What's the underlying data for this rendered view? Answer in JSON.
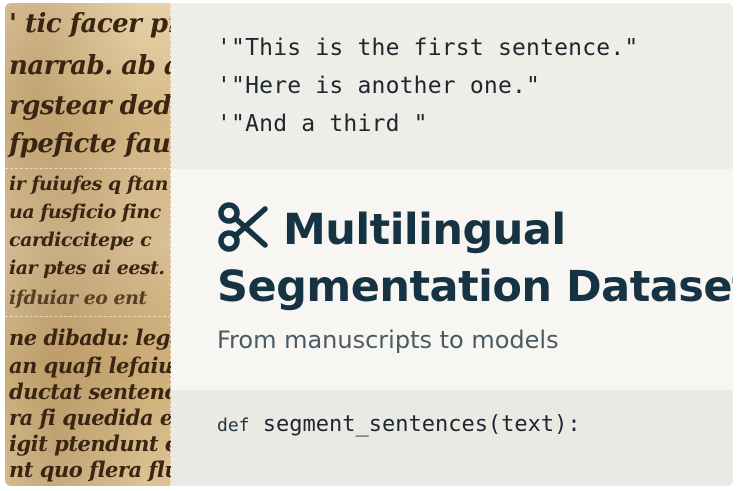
{
  "manuscript": {
    "lines": [
      "' tic facer pro",
      "narrab. ab a",
      "rgstear ded",
      "fpeficte fau",
      "ir fuiufes q ftan",
      "ua fusficio finc",
      "cardiccitepe c",
      "iar ptes ai eest.",
      "ifduiar eo ent",
      "ne dibadu: lega",
      "an quafi lefaiu",
      "ductat sentence.",
      "ra fi quedida e ti",
      "igit ptendunt e",
      "nt quo flera flu"
    ]
  },
  "top_code": {
    "lines": [
      "'\"This is the first sentence.\"",
      "'\"Here is another one.\"",
      "'\"And a third \""
    ]
  },
  "hero": {
    "icon": "scissors-icon",
    "title_line1": "Multilingual",
    "title_line2": "Segmentation Dataset",
    "subtitle": "From manuscripts to models"
  },
  "bottom_code": {
    "keyword": "def",
    "signature": "segment_sentences(text):"
  },
  "colors": {
    "title": "#163343",
    "subtitle": "#4b5a63",
    "code": "#1c2730",
    "panel_top": "#efede7",
    "panel_mid": "#f7f6f2",
    "panel_bottom": "#ebe9e3",
    "parchment": "#e0c89a",
    "ink": "#3a2412"
  }
}
